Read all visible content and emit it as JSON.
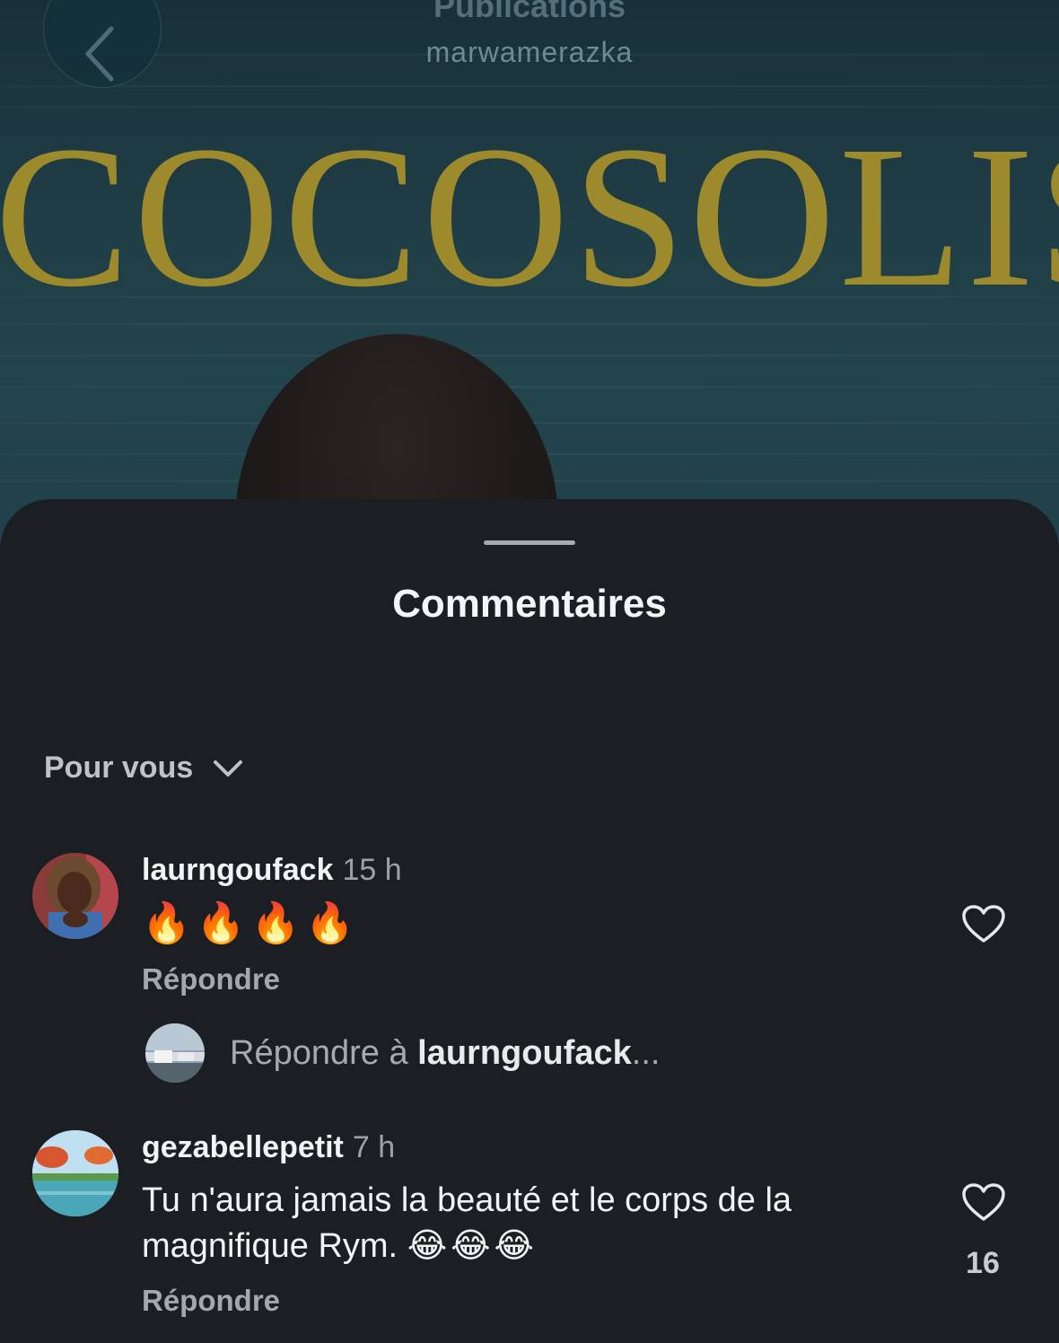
{
  "header": {
    "title": "Publications",
    "subtitle": "marwamerazka"
  },
  "post": {
    "title_text": "COCOSOLIS"
  },
  "sheet": {
    "title": "Commentaires",
    "filter_label": "Pour vous"
  },
  "comments": [
    {
      "username": "laurngoufack",
      "time": "15 h",
      "text": "🔥🔥🔥🔥",
      "reply_label": "Répondre",
      "like_count": ""
    },
    {
      "username": "gezabellepetit",
      "time": "7 h",
      "text_line1": "Tu n'aura jamais la beauté et le corps de la",
      "text_line2": "magnifique Rym.",
      "text_emojis": "😂😂😂",
      "reply_label": "Répondre",
      "like_count": "16"
    }
  ],
  "reply_box": {
    "prefix": "Répondre à",
    "target": "laurngoufack",
    "suffix": "..."
  },
  "colors": {
    "sheet_bg": "#1b1e23",
    "title_gold": "#9c8a2c",
    "text_primary": "#f2f3f4",
    "text_secondary": "#a4a8ad"
  },
  "icons": {
    "back": "chevron-left-icon",
    "filter": "chevron-down-icon",
    "like": "heart-outline-icon"
  }
}
